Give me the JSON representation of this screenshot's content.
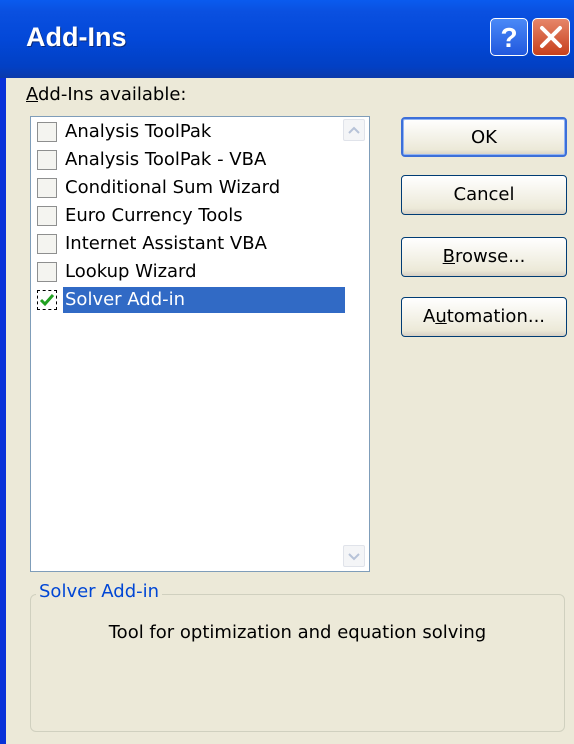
{
  "window": {
    "title": "Add-Ins"
  },
  "list": {
    "label": "Add-Ins available:",
    "items": [
      {
        "label": "Analysis ToolPak",
        "checked": false
      },
      {
        "label": "Analysis ToolPak - VBA",
        "checked": false
      },
      {
        "label": "Conditional Sum Wizard",
        "checked": false
      },
      {
        "label": "Euro Currency Tools",
        "checked": false
      },
      {
        "label": "Internet Assistant VBA",
        "checked": false
      },
      {
        "label": "Lookup Wizard",
        "checked": false
      },
      {
        "label": "Solver Add-in",
        "checked": true,
        "selected": true
      }
    ]
  },
  "buttons": {
    "ok": "OK",
    "cancel": "Cancel",
    "browse_pre": "B",
    "browse_rest": "rowse...",
    "automation_pre": "A",
    "automation_mn": "u",
    "automation_rest": "tomation..."
  },
  "label_accel": {
    "first": "A",
    "rest": "dd-Ins available:"
  },
  "description": {
    "heading": "Solver Add-in",
    "text": "Tool for optimization and equation solving"
  }
}
